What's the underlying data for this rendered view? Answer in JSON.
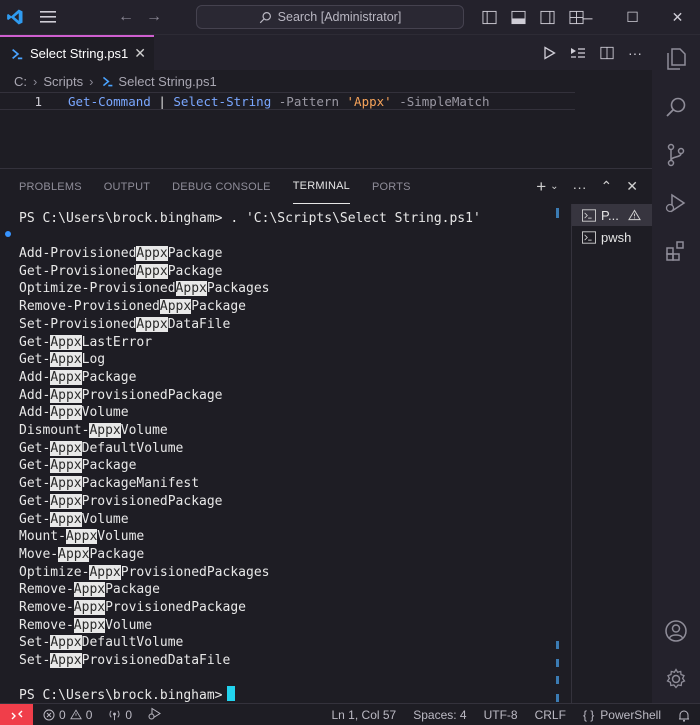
{
  "titlebar": {
    "search_text": "Search [Administrator]"
  },
  "tabs": [
    {
      "label": "Select String.ps1"
    }
  ],
  "breadcrumb": {
    "drive": "C:",
    "folder": "Scripts",
    "file": "Select String.ps1"
  },
  "editor": {
    "line_number": "1",
    "tokens": {
      "cmd1": "Get-Command",
      "pipe": "|",
      "cmd2": "Select-String",
      "param1": "-Pattern",
      "str": "'Appx'",
      "param2": "-SimpleMatch"
    }
  },
  "panel": {
    "tabs": [
      "PROBLEMS",
      "OUTPUT",
      "DEBUG CONSOLE",
      "TERMINAL",
      "PORTS"
    ],
    "active_tab": "TERMINAL"
  },
  "terminal": {
    "prompt": "PS C:\\Users\\brock.bingham>",
    "command": " . 'C:\\Scripts\\Select String.ps1'",
    "match": "Appx",
    "results": [
      [
        "Add-Provisioned",
        "Package"
      ],
      [
        "Get-Provisioned",
        "Package"
      ],
      [
        "Optimize-Provisioned",
        "Packages"
      ],
      [
        "Remove-Provisioned",
        "Package"
      ],
      [
        "Set-Provisioned",
        "DataFile"
      ],
      [
        "Get-",
        "LastError"
      ],
      [
        "Get-",
        "Log"
      ],
      [
        "Add-",
        "Package"
      ],
      [
        "Add-",
        "ProvisionedPackage"
      ],
      [
        "Add-",
        "Volume"
      ],
      [
        "Dismount-",
        "Volume"
      ],
      [
        "Get-",
        "DefaultVolume"
      ],
      [
        "Get-",
        "Package"
      ],
      [
        "Get-",
        "PackageManifest"
      ],
      [
        "Get-",
        "ProvisionedPackage"
      ],
      [
        "Get-",
        "Volume"
      ],
      [
        "Mount-",
        "Volume"
      ],
      [
        "Move-",
        "Package"
      ],
      [
        "Optimize-",
        "ProvisionedPackages"
      ],
      [
        "Remove-",
        "Package"
      ],
      [
        "Remove-",
        "ProvisionedPackage"
      ],
      [
        "Remove-",
        "Volume"
      ],
      [
        "Set-",
        "DefaultVolume"
      ],
      [
        "Set-",
        "ProvisionedDataFile"
      ]
    ],
    "final_prompt": "PS C:\\Users\\brock.bingham>"
  },
  "terminal_list": [
    {
      "label": "P...",
      "warning": true
    },
    {
      "label": "pwsh",
      "warning": false
    }
  ],
  "statusbar": {
    "errors": "0",
    "warnings": "0",
    "ports": "0",
    "position": "Ln 1, Col 57",
    "spaces": "Spaces: 4",
    "encoding": "UTF-8",
    "eol": "CRLF",
    "language": "PowerShell",
    "language_prefix": "{ }"
  },
  "colors": {
    "accent_tab": "#cf5fd0",
    "remote_button": "#f03e4a",
    "terminal_cursor": "#22d3ee",
    "string_token": "#f6a35a",
    "command_token": "#7aa7ff"
  }
}
